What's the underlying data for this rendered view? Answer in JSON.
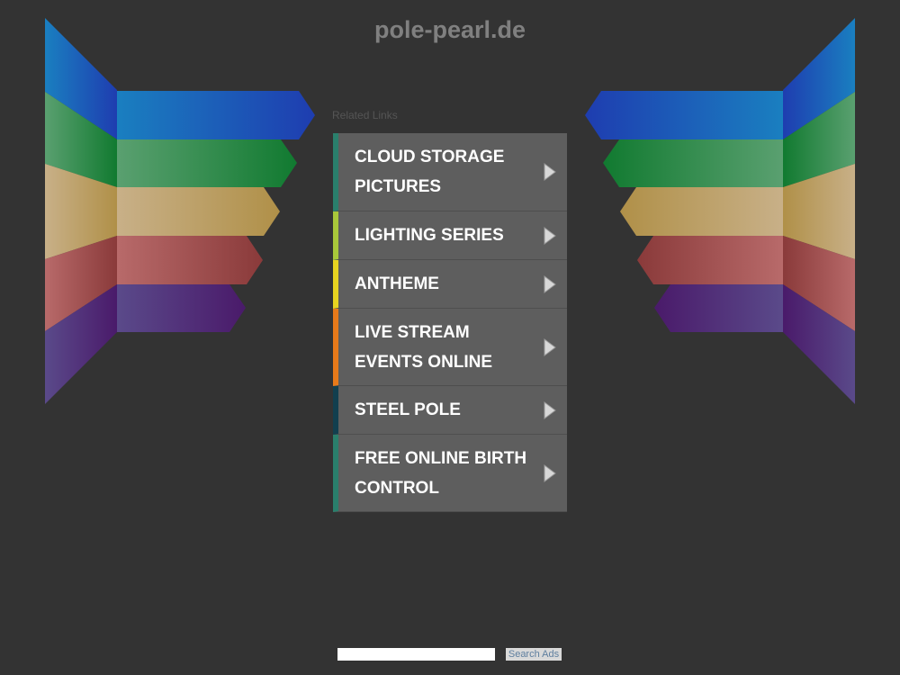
{
  "site": {
    "title": "pole-pearl.de"
  },
  "related": {
    "label": "Related Links"
  },
  "links": [
    {
      "label": "CLOUD STORAGE PICTURES",
      "accent": "#2a7f6c"
    },
    {
      "label": "LIGHTING SERIES",
      "accent": "#a8c83a"
    },
    {
      "label": "ANTHEME",
      "accent": "#e8d420"
    },
    {
      "label": "LIVE STREAM EVENTS ONLINE",
      "accent": "#e87a1a"
    },
    {
      "label": "STEEL POLE",
      "accent": "#123f4f"
    },
    {
      "label": "FREE ONLINE BIRTH CONTROL",
      "accent": "#2a7f6c"
    }
  ],
  "search": {
    "input_value": "",
    "button_label": "Search Ads"
  },
  "icons": {
    "link_arrow": "chevron-right-icon"
  },
  "colors": {
    "background": "#333333",
    "wing_blue": "#1a55b8",
    "wing_green": "#1c8040",
    "wing_tan": "#b8a060",
    "wing_red": "#9a4848",
    "wing_purple": "#4a2a78"
  }
}
